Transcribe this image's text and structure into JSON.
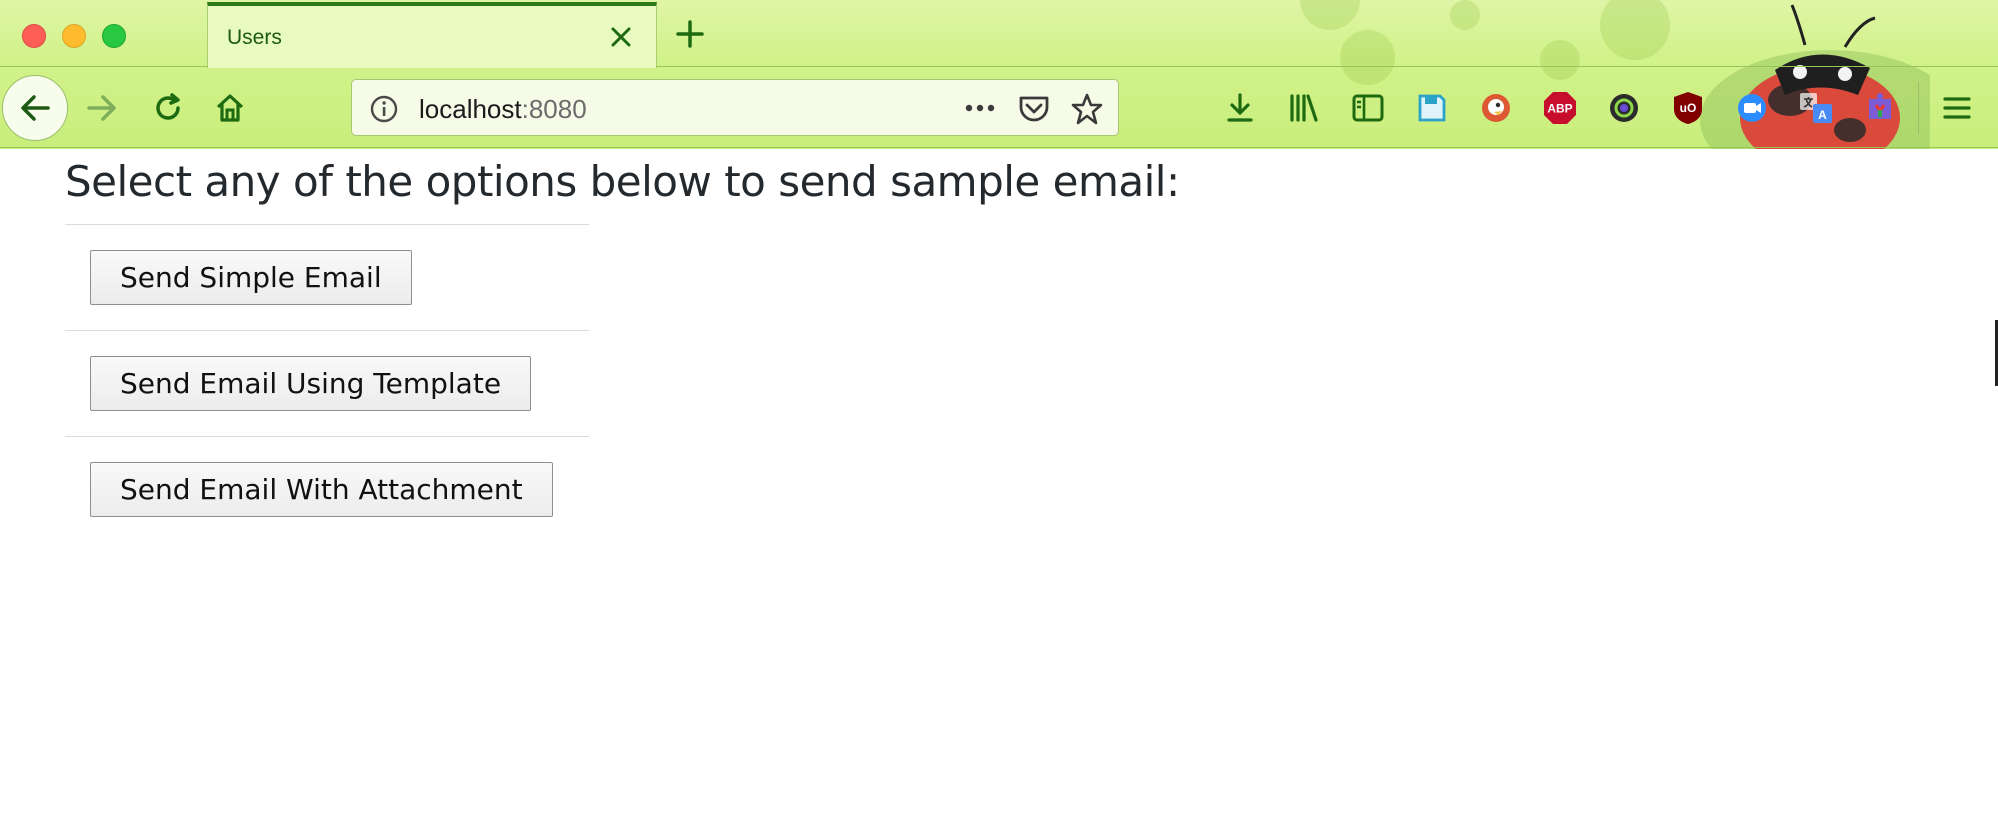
{
  "browser": {
    "tab": {
      "title": "Users"
    },
    "address": {
      "host": "localhost",
      "port": ":8080"
    },
    "toolbar_icons": [
      "download-icon",
      "library-icon",
      "sidebar-icon",
      "save-icon",
      "duckduckgo-icon",
      "adblock-plus-icon",
      "camera-lens-icon",
      "ublock-origin-icon",
      "zoom-icon",
      "translate-icon",
      "puzzle-extension-icon"
    ],
    "extension_badges": {
      "adblock": "ABP",
      "ublock": "uO"
    },
    "theme_colors": {
      "accent": "#2f7a1a",
      "frame": "#d2f28a",
      "tab": "#e8fac0"
    }
  },
  "page": {
    "title": "Select any of the options below to send sample email:",
    "options": [
      {
        "label": "Send Simple Email"
      },
      {
        "label": "Send Email Using Template"
      },
      {
        "label": "Send Email With Attachment"
      }
    ]
  }
}
